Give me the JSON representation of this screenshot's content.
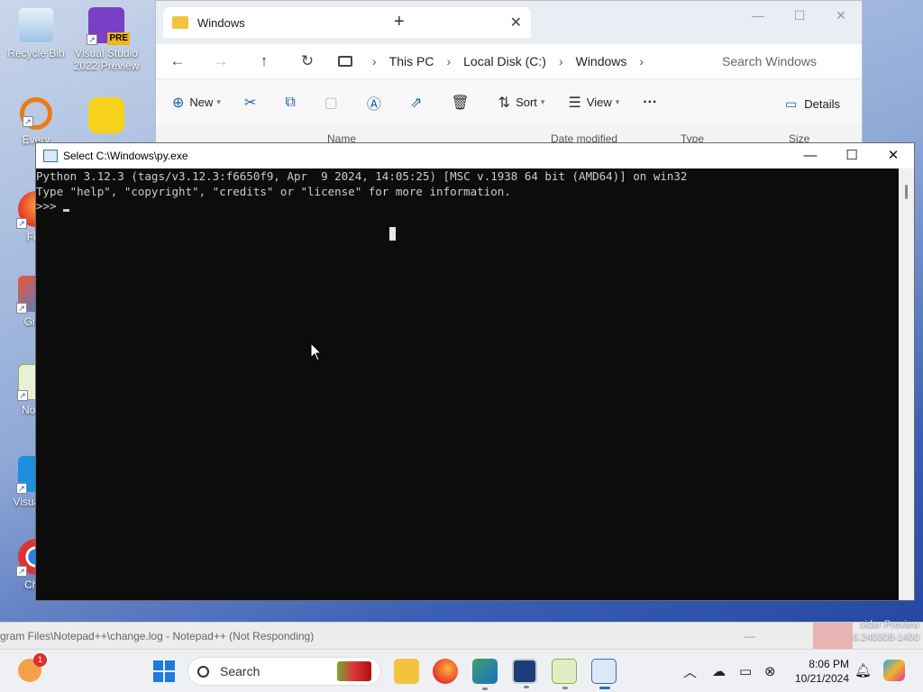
{
  "desktop": {
    "icons": [
      {
        "label": "Recycle Bin"
      },
      {
        "label": "Visual Studio 2022 Preview",
        "badge": "PRE"
      },
      {
        "label": "Every"
      },
      {
        "label": "Fire"
      },
      {
        "label": "Git B"
      },
      {
        "label": "Notep"
      },
      {
        "label": "Visual Co"
      },
      {
        "label": "Chro"
      }
    ]
  },
  "explorer": {
    "tab_label": "Windows",
    "new_tab": "+",
    "window_controls": {
      "minimize": "—",
      "maximize": "☐",
      "close": "✕"
    },
    "nav": {
      "back": "←",
      "forward": "→",
      "up": "↑",
      "refresh": "↻"
    },
    "breadcrumbs": [
      "This PC",
      "Local Disk (C:)",
      "Windows"
    ],
    "breadcrumb_sep": "›",
    "search_placeholder": "Search Windows",
    "commands": {
      "new": "New",
      "sort": "Sort",
      "view": "View",
      "more": "···",
      "details": "Details"
    },
    "columns": [
      "Name",
      "Date modified",
      "Type",
      "Size"
    ]
  },
  "console": {
    "title": "Select C:\\Windows\\py.exe",
    "lines": [
      "Python 3.12.3 (tags/v3.12.3:f6650f9, Apr  9 2024, 14:05:25) [MSC v.1938 64 bit (AMD64)] on win32",
      "Type \"help\", \"copyright\", \"credits\" or \"license\" for more information.",
      ">>> "
    ],
    "controls": {
      "minimize": "—",
      "maximize": "☐",
      "close": "✕"
    }
  },
  "background_window": {
    "title": "gram Files\\Notepad++\\change.log - Notepad++ (Not Responding)"
  },
  "watermark": {
    "line1": "sider Preview",
    "line2": "6.240308-1400"
  },
  "taskbar": {
    "weather_badge": "1",
    "search_label": "Search",
    "clock_time": "8:06 PM",
    "clock_date": "10/21/2024"
  }
}
